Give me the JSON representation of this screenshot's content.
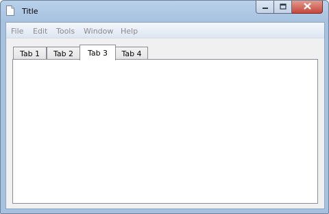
{
  "window": {
    "title": "Title"
  },
  "menu": [
    "File",
    "Edit",
    "Tools",
    "Window",
    "Help"
  ],
  "tabs": [
    {
      "label": "Tab 1",
      "active": false
    },
    {
      "label": "Tab 2",
      "active": false
    },
    {
      "label": "Tab 3",
      "active": true
    },
    {
      "label": "Tab 4",
      "active": false
    }
  ],
  "icons": {
    "app": "document-icon",
    "minimize": "minimize-icon",
    "maximize": "maximize-icon",
    "close": "close-icon"
  },
  "colors": {
    "close_button": "#c4483a",
    "menu_text_disabled": "#8a8a8a"
  }
}
